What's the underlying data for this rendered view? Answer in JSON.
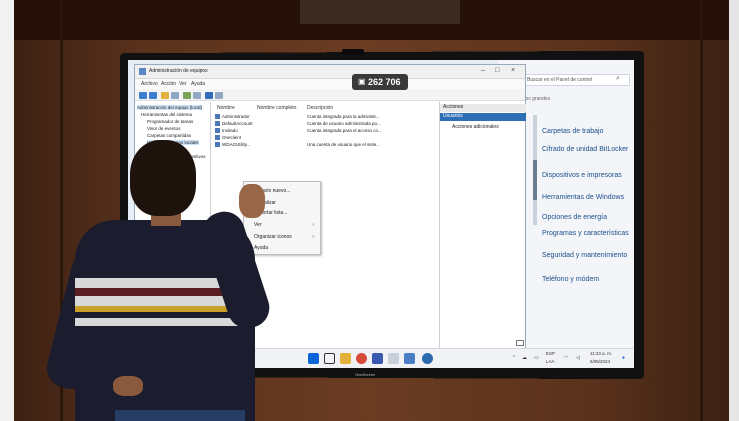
{
  "badge": {
    "icon": "camera-icon",
    "value": "262 706"
  },
  "mmc": {
    "title": "Administración de equipos",
    "menu": [
      "Archivo",
      "Acción",
      "Ver",
      "Ayuda"
    ],
    "tree": [
      "Administración del equipo (local)",
      "Herramientas del sistema",
      "Programador de tareas",
      "Visor de eventos",
      "Carpetas compartidas",
      "Usuarios y grupos locales",
      "Rendimiento",
      "Administrador de dispositivos",
      "Almacenamiento",
      "Servicios y Aplicaciones"
    ],
    "columns": {
      "name": "Nombre",
      "full_name": "Nombre completo",
      "description": "Descripción"
    },
    "rows": [
      {
        "name": "Administrador",
        "desc": "Cuenta integrada para la administr..."
      },
      {
        "name": "DefaultAccount",
        "desc": "Cuenta de usuario administrada po..."
      },
      {
        "name": "Invitado",
        "desc": "Cuenta integrada para el acceso co..."
      },
      {
        "name": "Oneclient",
        "desc": ""
      },
      {
        "name": "WDAGUtility...",
        "desc": "Una cuenta de usuario que el siste..."
      }
    ],
    "context_menu": [
      "Usuario nuevo...",
      "Actualizar",
      "Exportar lista...",
      "Ver",
      "Organizar iconos",
      "Ayuda"
    ],
    "actions": {
      "header": "Acciones",
      "selected": "Usuarios",
      "more": "Acciones adicionales"
    }
  },
  "control_panel": {
    "search_placeholder": "Buscar en el Panel de control",
    "view_by": "por: Iconos grandes",
    "items": [
      "Carpetas de trabajo",
      "Cifrado de unidad BitLocker",
      "Dispositivos e impresoras",
      "Herramientas de Windows",
      "Opciones de energía",
      "Programas y características",
      "Seguridad y mantenimiento",
      "Teléfono y módem"
    ]
  },
  "taskbar": {
    "icons": [
      "start-icon",
      "search-icon",
      "file-explorer-icon",
      "chrome-icon",
      "store-icon",
      "notepad-icon",
      "photos-icon",
      "network-icon"
    ],
    "lang": "ESP",
    "lang_sub": "LAA",
    "time": "11:23 a. m.",
    "date": "6/05/2024"
  },
  "monitor_brand": "OneScreen",
  "colors": {
    "accent": "#2f6fb5",
    "start": "#0b64d8",
    "link": "#1b4f8c"
  }
}
